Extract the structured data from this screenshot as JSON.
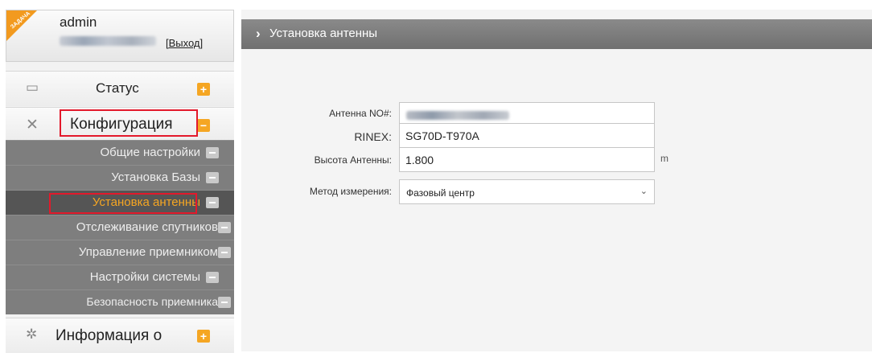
{
  "user": {
    "ribbon_text": "ЗАДАЧА",
    "name": "admin",
    "logout": "[Выход]"
  },
  "sidebar": {
    "items": [
      {
        "label": "Статус",
        "icon": "monitor-icon",
        "action": "+"
      },
      {
        "label": "Конфигурация",
        "icon": "tools-icon",
        "action": "-"
      },
      {
        "label": "Информация о",
        "icon": "info-icon",
        "action": "+"
      }
    ],
    "subitems": [
      {
        "label": "Общие настройки"
      },
      {
        "label": "Установка Базы"
      },
      {
        "label": "Установка антенны"
      },
      {
        "label": "Отслеживание спутников"
      },
      {
        "label": "Управление приемником"
      },
      {
        "label": "Настройки системы"
      },
      {
        "label": "Безопасность приемника"
      }
    ],
    "active_subitem": "Установка антенны"
  },
  "main": {
    "title": "Установка антенны",
    "fields": {
      "antenna_no_label": "Антенна NO#:",
      "rinex_label": "RINEX:",
      "rinex_value": "SG70D-T970A",
      "height_label": "Высота Антенны:",
      "height_value": "1.800",
      "height_unit": "m",
      "method_label": "Метод измерения:",
      "method_value": "Фазовый центр"
    }
  },
  "colors": {
    "accent": "#f5a623",
    "highlight": "#e3192b",
    "submenu_bg": "#7e7e7e",
    "header_bg": "#7a7a7a"
  }
}
